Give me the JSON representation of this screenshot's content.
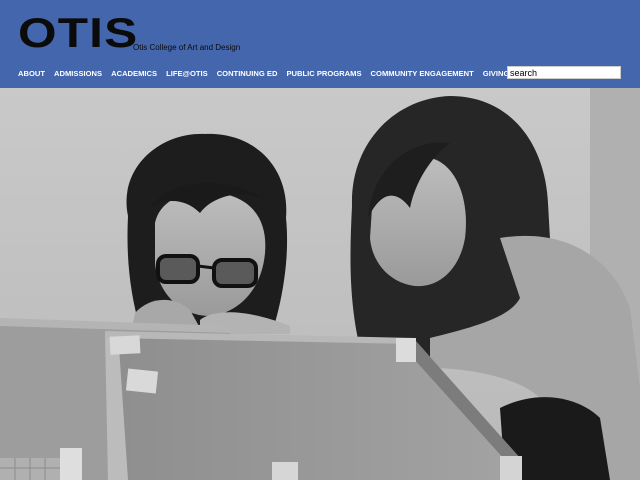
{
  "header": {
    "logo": "OTIS",
    "tagline": "Otis College of Art and Design"
  },
  "nav": {
    "items": [
      "ABOUT",
      "ADMISSIONS",
      "ACADEMICS",
      "LIFE@OTIS",
      "CONTINUING ED",
      "PUBLIC PROGRAMS",
      "COMMUNITY ENGAGEMENT",
      "GIVING"
    ]
  },
  "search": {
    "value": "search"
  },
  "colors": {
    "header_bg": "#4466ac",
    "logo": "#0b0b0b",
    "nav_text": "#ffffff"
  },
  "hero": {
    "description_icon": "photo-two-students-cardboard-model"
  }
}
